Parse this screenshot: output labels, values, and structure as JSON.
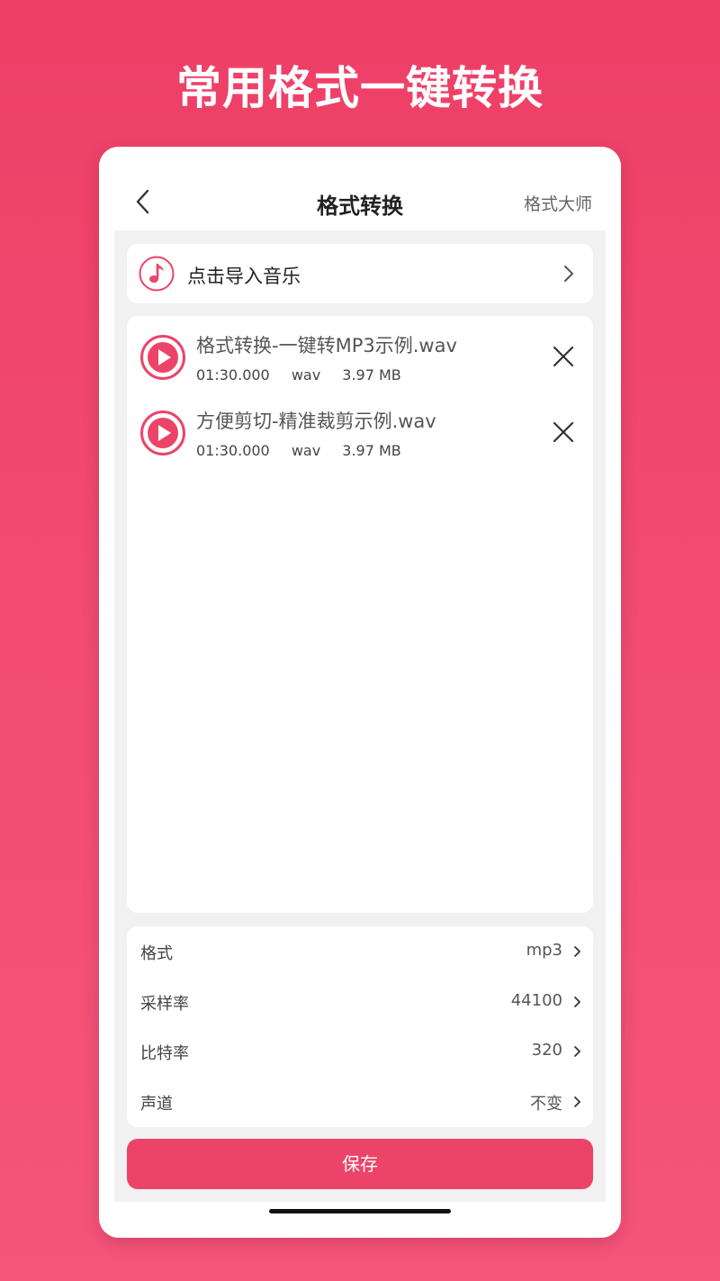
{
  "headline": "常用格式一键转换",
  "navbar": {
    "title": "格式转换",
    "right_label": "格式大师"
  },
  "import": {
    "label": "点击导入音乐"
  },
  "files": [
    {
      "name": "格式转换-一键转MP3示例.wav",
      "duration": "01:30.000",
      "format": "wav",
      "size": "3.97 MB"
    },
    {
      "name": "方便剪切-精准裁剪示例.wav",
      "duration": "01:30.000",
      "format": "wav",
      "size": "3.97 MB"
    }
  ],
  "settings": [
    {
      "label": "格式",
      "value": "mp3"
    },
    {
      "label": "采样率",
      "value": "44100"
    },
    {
      "label": "比特率",
      "value": "320"
    },
    {
      "label": "声道",
      "value": "不变"
    }
  ],
  "save_label": "保存",
  "colors": {
    "accent": "#ec4468",
    "background": "#f24c73"
  },
  "icons": {
    "back": "chevron-left-icon",
    "music": "music-note-icon",
    "play": "play-icon",
    "close": "close-icon",
    "chevron": "chevron-right-icon"
  }
}
